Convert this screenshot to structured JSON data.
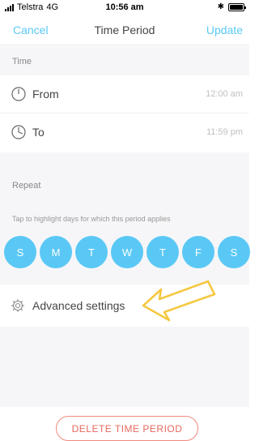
{
  "status_bar": {
    "carrier": "Telstra",
    "network": "4G",
    "time": "10:56 am",
    "bluetooth_glyph": "✱",
    "battery_level": 1.0
  },
  "nav": {
    "cancel_label": "Cancel",
    "title": "Time Period",
    "update_label": "Update"
  },
  "time_section": {
    "header": "Time",
    "from": {
      "label": "From",
      "value": "12:00 am",
      "icon": "clock-icon"
    },
    "to": {
      "label": "To",
      "value": "11:59 pm",
      "icon": "clock-icon"
    }
  },
  "repeat_section": {
    "header": "Repeat",
    "hint": "Tap to highlight days for which this period applies",
    "days": [
      "S",
      "M",
      "T",
      "W",
      "T",
      "F",
      "S"
    ]
  },
  "advanced": {
    "label": "Advanced settings",
    "icon": "gear-icon"
  },
  "delete_label": "DELETE TIME PERIOD",
  "colors": {
    "accent": "#5bc8f5",
    "day_circle": "#5ac8f5",
    "danger": "#e8695e",
    "annotation_arrow": "#f5c842"
  }
}
